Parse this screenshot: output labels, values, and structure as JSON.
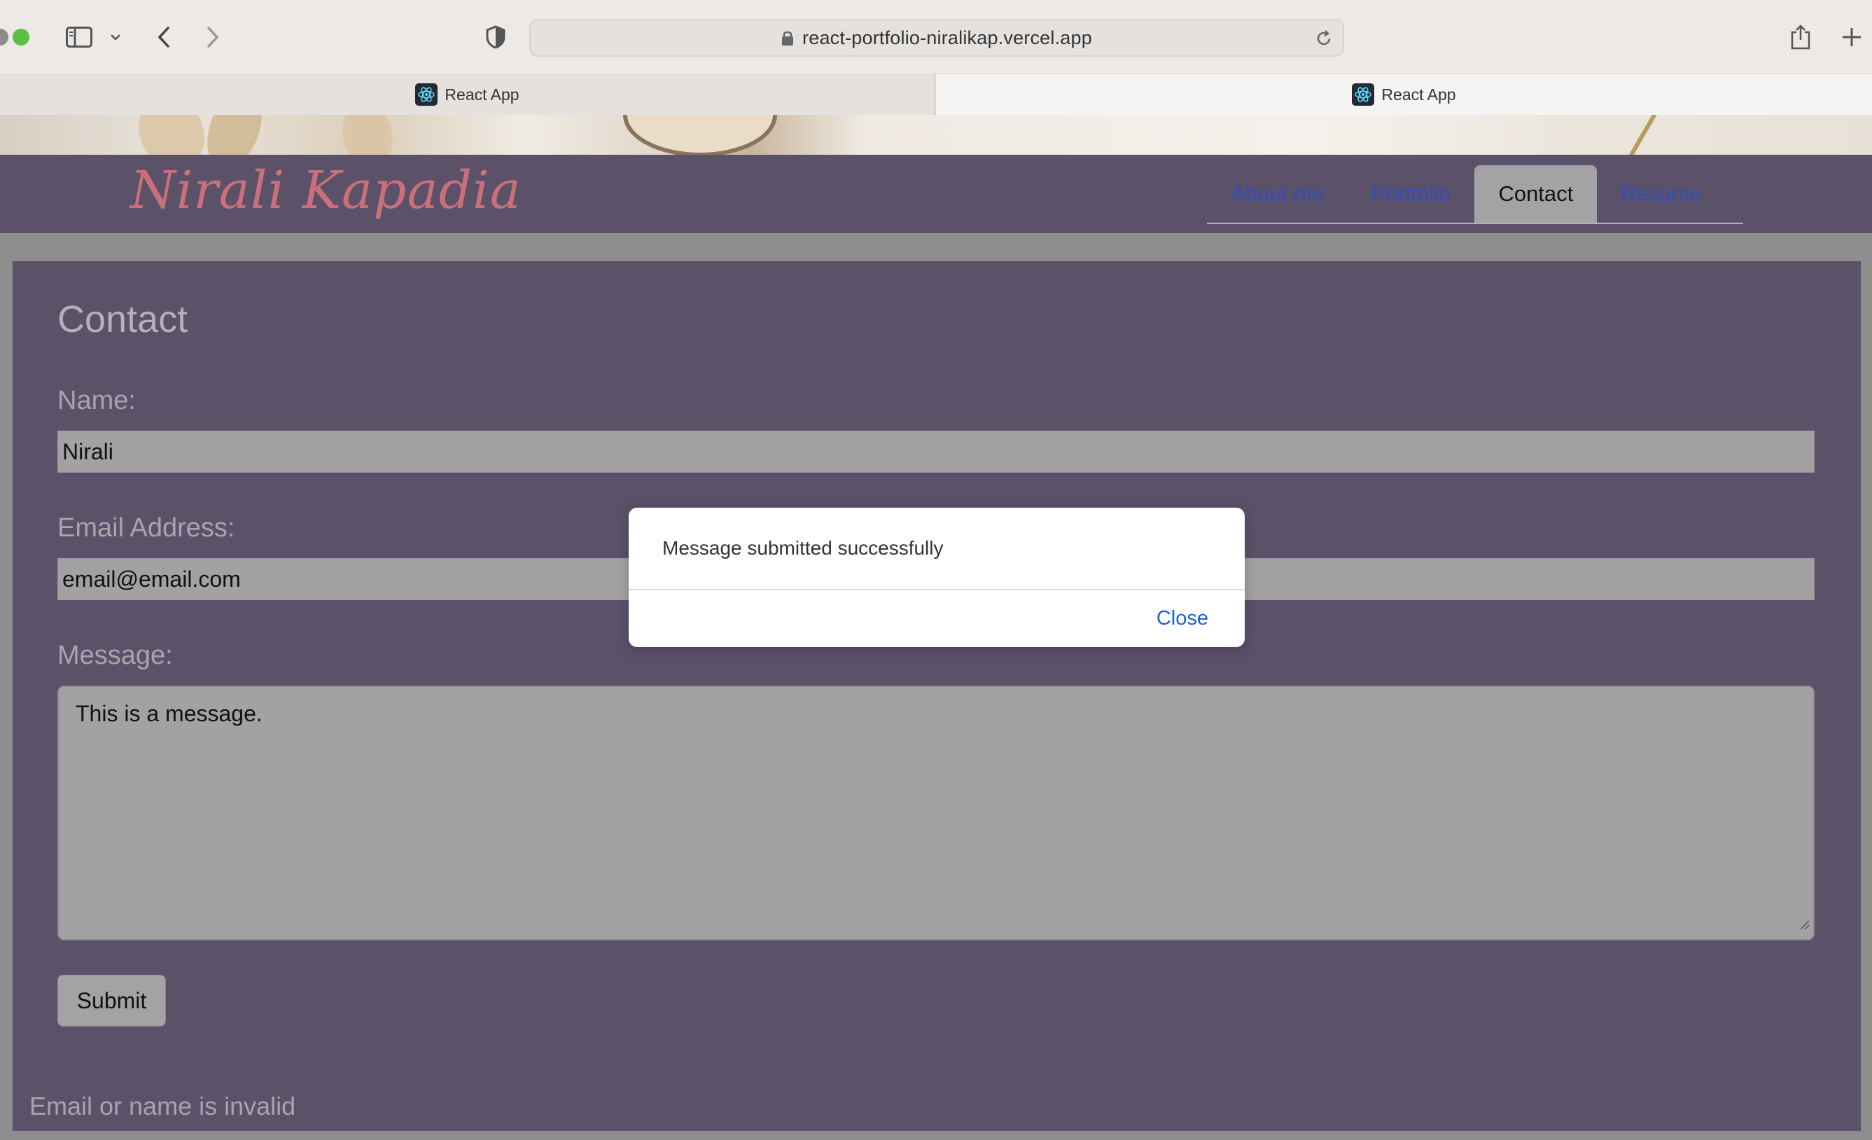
{
  "browser": {
    "url": "react-portfolio-niralikap.vercel.app",
    "tabs": [
      {
        "title": "React App"
      },
      {
        "title": "React App"
      }
    ]
  },
  "site": {
    "brand": "Nirali Kapadia",
    "nav": [
      {
        "label": "About me"
      },
      {
        "label": "Portfolio"
      },
      {
        "label": "Contact",
        "active": true
      },
      {
        "label": "Resume"
      }
    ]
  },
  "contact": {
    "heading": "Contact",
    "name_label": "Name:",
    "name_value": "Nirali",
    "email_label": "Email Address:",
    "email_value": "email@email.com",
    "message_label": "Message:",
    "message_value": "This is a message.",
    "submit_label": "Submit",
    "error_text": "Email or name is invalid"
  },
  "modal": {
    "message": "Message submitted successfully",
    "close_label": "Close"
  },
  "colors": {
    "navbar_bg": "#5b5169",
    "brand_color": "#c9707a",
    "nav_link": "#2f4fbf",
    "modal_link": "#1a63d6"
  }
}
